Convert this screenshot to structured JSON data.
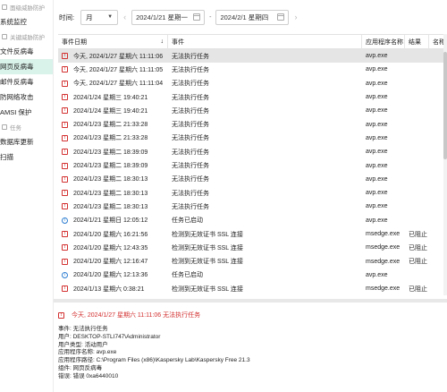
{
  "sidebar": {
    "section1": "面级威胁防护",
    "item_system_monitor": "系统监控",
    "section2": "关键威胁防护",
    "items": [
      "文件反病毒",
      "网页反病毒",
      "邮件反病毒",
      "防网络攻击",
      "AMSI 保护"
    ],
    "section3": "任务",
    "tasks": [
      "数据库更新",
      "扫描"
    ],
    "active_index": 1
  },
  "filter": {
    "time_label": "时间:",
    "period": "月",
    "start_date": "2024/1/21 星期一",
    "end_date": "2024/2/1 星期四"
  },
  "table": {
    "headers": [
      "事件日期",
      "事件",
      "应用程序名称",
      "结果",
      "名称"
    ],
    "rows": [
      {
        "icon": "error",
        "date": "今天, 2024/1/27 星期六 11:11:06",
        "event": "无法执行任务",
        "app": "avp.exe",
        "result": ""
      },
      {
        "icon": "error",
        "date": "今天, 2024/1/27 星期六 11:11:05",
        "event": "无法执行任务",
        "app": "avp.exe",
        "result": ""
      },
      {
        "icon": "error",
        "date": "今天, 2024/1/27 星期六 11:11:04",
        "event": "无法执行任务",
        "app": "avp.exe",
        "result": ""
      },
      {
        "icon": "error",
        "date": "2024/1/24 星期三 19:40:21",
        "event": "无法执行任务",
        "app": "avp.exe",
        "result": ""
      },
      {
        "icon": "error",
        "date": "2024/1/24 星期三 19:40:21",
        "event": "无法执行任务",
        "app": "avp.exe",
        "result": ""
      },
      {
        "icon": "error",
        "date": "2024/1/23 星期二 21:33:28",
        "event": "无法执行任务",
        "app": "avp.exe",
        "result": ""
      },
      {
        "icon": "error",
        "date": "2024/1/23 星期二 21:33:28",
        "event": "无法执行任务",
        "app": "avp.exe",
        "result": ""
      },
      {
        "icon": "error",
        "date": "2024/1/23 星期二 18:39:09",
        "event": "无法执行任务",
        "app": "avp.exe",
        "result": ""
      },
      {
        "icon": "error",
        "date": "2024/1/23 星期二 18:39:09",
        "event": "无法执行任务",
        "app": "avp.exe",
        "result": ""
      },
      {
        "icon": "error",
        "date": "2024/1/23 星期二 18:30:13",
        "event": "无法执行任务",
        "app": "avp.exe",
        "result": ""
      },
      {
        "icon": "error",
        "date": "2024/1/23 星期二 18:30:13",
        "event": "无法执行任务",
        "app": "avp.exe",
        "result": ""
      },
      {
        "icon": "error",
        "date": "2024/1/23 星期二 18:30:13",
        "event": "无法执行任务",
        "app": "avp.exe",
        "result": ""
      },
      {
        "icon": "info",
        "date": "2024/1/21 星期日 12:05:12",
        "event": "任务已启动",
        "app": "avp.exe",
        "result": ""
      },
      {
        "icon": "error",
        "date": "2024/1/20 星期六 16:21:56",
        "event": "检测到无效证书 SSL 连接",
        "app": "msedge.exe",
        "result": "已阻止"
      },
      {
        "icon": "error",
        "date": "2024/1/20 星期六 12:43:35",
        "event": "检测到无效证书 SSL 连接",
        "app": "msedge.exe",
        "result": "已阻止"
      },
      {
        "icon": "error",
        "date": "2024/1/20 星期六 12:16:47",
        "event": "检测到无效证书 SSL 连接",
        "app": "msedge.exe",
        "result": "已阻止"
      },
      {
        "icon": "info",
        "date": "2024/1/20 星期六 12:13:36",
        "event": "任务已启动",
        "app": "avp.exe",
        "result": ""
      },
      {
        "icon": "error",
        "date": "2024/1/13 星期六 0:38:21",
        "event": "检测到无效证书 SSL 连接",
        "app": "msedge.exe",
        "result": "已阻止"
      }
    ]
  },
  "details": {
    "header": "今天, 2024/1/27 星期六 11:11:06 无法执行任务",
    "lines": [
      "事件: 无法执行任务",
      "用户: DESKTOP-STLI747\\Administrator",
      "用户类型: 活动用户",
      "应用程序名称: avp.exe",
      "应用程序路径: C:\\Program Files (x86)\\Kaspersky Lab\\Kaspersky Free 21.3",
      "组件: 网页反病毒",
      "错误: 错误 0xa6440010"
    ]
  },
  "colors": {
    "active_nav": "#d9f2ea",
    "error": "#d32f2f",
    "info": "#2e7dd1",
    "selected_row": "#e5e5e5"
  }
}
